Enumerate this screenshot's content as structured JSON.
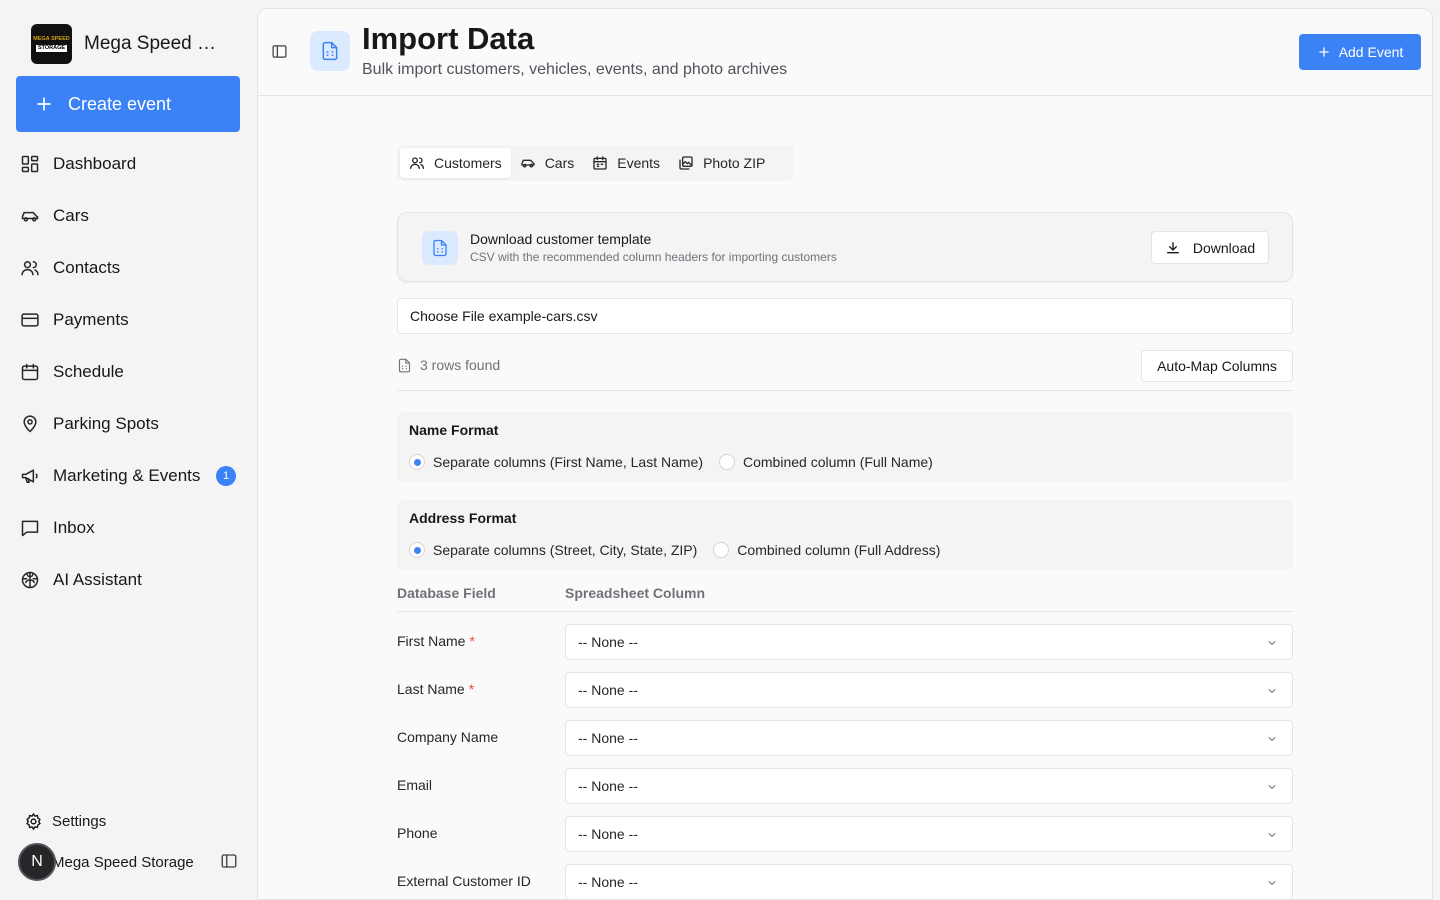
{
  "sidebar": {
    "brand": {
      "name": "Mega Speed Storage",
      "logo_top": "MEGA SPEED",
      "logo_bottom": "STORAGE"
    },
    "create_label": "Create event",
    "items": [
      {
        "label": "Dashboard",
        "icon": "dashboard-icon"
      },
      {
        "label": "Cars",
        "icon": "car-icon"
      },
      {
        "label": "Contacts",
        "icon": "users-icon"
      },
      {
        "label": "Payments",
        "icon": "credit-card-icon"
      },
      {
        "label": "Schedule",
        "icon": "calendar-icon"
      },
      {
        "label": "Parking Spots",
        "icon": "map-pin-icon"
      },
      {
        "label": "Marketing & Events",
        "icon": "megaphone-icon",
        "badge": "1"
      },
      {
        "label": "Inbox",
        "icon": "message-square-icon"
      },
      {
        "label": "AI Assistant",
        "icon": "brain-icon"
      }
    ],
    "settings_label": "Settings",
    "user": {
      "initial": "N",
      "name": "Mega Speed Storage"
    }
  },
  "header": {
    "title": "Import Data",
    "subtitle": "Bulk import customers, vehicles, events, and photo archives",
    "add_event_label": "Add Event"
  },
  "tabs": [
    {
      "label": "Customers",
      "active": true
    },
    {
      "label": "Cars",
      "active": false
    },
    {
      "label": "Events",
      "active": false
    },
    {
      "label": "Photo ZIP",
      "active": false
    }
  ],
  "template": {
    "title": "Download customer template",
    "subtitle": "CSV with the recommended column headers for importing customers",
    "download_label": "Download"
  },
  "file_input": {
    "button": "Choose File",
    "filename": "example-cars.csv"
  },
  "rows_found": "3 rows found",
  "automap_label": "Auto-Map Columns",
  "name_format": {
    "title": "Name Format",
    "options": [
      "Separate columns (First Name, Last Name)",
      "Combined column (Full Name)"
    ],
    "selected": 0
  },
  "address_format": {
    "title": "Address Format",
    "options": [
      "Separate columns (Street, City, State, ZIP)",
      "Combined column (Full Address)"
    ],
    "selected": 0
  },
  "mapping": {
    "col_field": "Database Field",
    "col_column": "Spreadsheet Column",
    "rows": [
      {
        "field": "First Name",
        "required": true,
        "value": "-- None --"
      },
      {
        "field": "Last Name",
        "required": true,
        "value": "-- None --"
      },
      {
        "field": "Company Name",
        "required": false,
        "value": "-- None --"
      },
      {
        "field": "Email",
        "required": false,
        "value": "-- None --"
      },
      {
        "field": "Phone",
        "required": false,
        "value": "-- None --"
      },
      {
        "field": "External Customer ID",
        "required": false,
        "value": "-- None --"
      }
    ]
  },
  "colors": {
    "accent": "#3b82f6",
    "required": "#ef4444"
  }
}
